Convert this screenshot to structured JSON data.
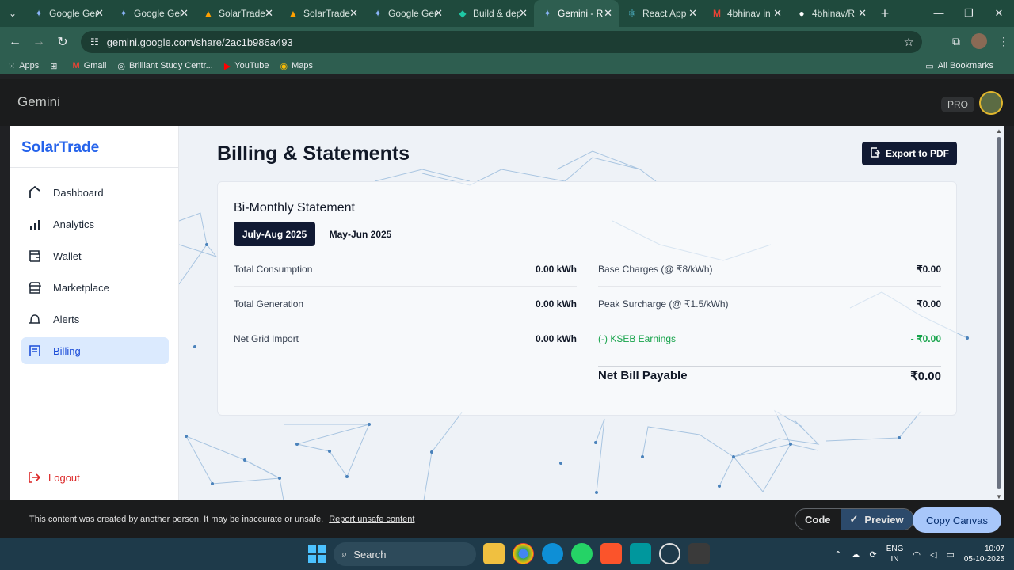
{
  "browser": {
    "tabs": [
      {
        "label": "Google Gemini",
        "icon": "gemini-icon"
      },
      {
        "label": "Google Gemini",
        "icon": "gemini-icon"
      },
      {
        "label": "SolarTrade",
        "icon": "firebase-icon"
      },
      {
        "label": "SolarTrade",
        "icon": "firebase-icon"
      },
      {
        "label": "Google Gemini",
        "icon": "gemini-icon"
      },
      {
        "label": "Build & deploy",
        "icon": "build-icon"
      },
      {
        "label": "Gemini - R",
        "icon": "gemini-icon",
        "active": true
      },
      {
        "label": "React App",
        "icon": "react-icon"
      },
      {
        "label": "4bhinav in",
        "icon": "gmail-icon"
      },
      {
        "label": "4bhinav/R",
        "icon": "github-icon"
      }
    ],
    "url": "gemini.google.com/share/2ac1b986a493",
    "bookmarks": [
      "Apps",
      "Gmail",
      "Brilliant Study Centr...",
      "YouTube",
      "Maps"
    ],
    "all_bookmarks": "All Bookmarks"
  },
  "gemini": {
    "title": "Gemini",
    "badge": "PRO"
  },
  "app": {
    "brand": "SolarTrade",
    "nav": [
      {
        "label": "Dashboard",
        "icon": "dashboard-icon"
      },
      {
        "label": "Analytics",
        "icon": "analytics-icon"
      },
      {
        "label": "Wallet",
        "icon": "wallet-icon"
      },
      {
        "label": "Marketplace",
        "icon": "marketplace-icon"
      },
      {
        "label": "Alerts",
        "icon": "bell-icon"
      },
      {
        "label": "Billing",
        "icon": "billing-icon",
        "active": true
      }
    ],
    "logout": "Logout",
    "page_title": "Billing & Statements",
    "export_label": "Export to PDF",
    "card_title": "Bi-Monthly Statement",
    "periods": [
      "July-Aug 2025",
      "May-Jun 2025"
    ],
    "left_rows": [
      {
        "label": "Total Consumption",
        "value": "0.00 kWh"
      },
      {
        "label": "Total Generation",
        "value": "0.00 kWh"
      },
      {
        "label": "Net Grid Import",
        "value": "0.00 kWh"
      }
    ],
    "right_rows": [
      {
        "label": "Base Charges (@ ₹8/kWh)",
        "value": "₹0.00"
      },
      {
        "label": "Peak Surcharge (@ ₹1.5/kWh)",
        "value": "₹0.00"
      },
      {
        "label": "(-) KSEB Earnings",
        "value": "- ₹0.00"
      }
    ],
    "net_label": "Net Bill Payable",
    "net_value": "₹0.00",
    "colors": {
      "brand": "#2563eb",
      "dark": "#111a33",
      "earnings": "#16a34a",
      "logout": "#dc2626"
    }
  },
  "footer": {
    "disclaimer": "This content was created by another person. It may be inaccurate or unsafe.",
    "report_link": "Report unsafe content",
    "code_label": "Code",
    "preview_label": "Preview",
    "copy_label": "Copy Canvas"
  },
  "taskbar": {
    "search": "Search",
    "lang1": "ENG",
    "lang2": "IN",
    "time": "10:07",
    "date": "05-10-2025"
  }
}
